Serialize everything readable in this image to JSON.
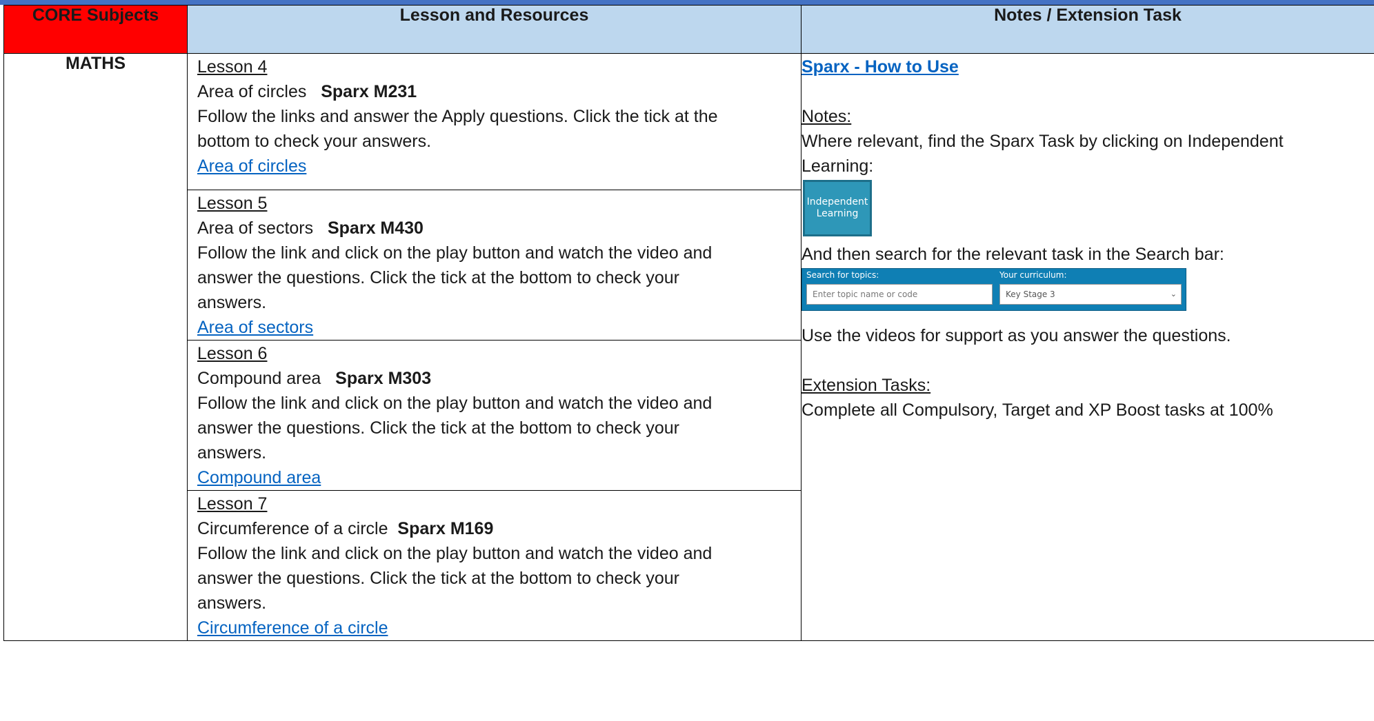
{
  "table": {
    "headers": {
      "core": "CORE Subjects",
      "lessons": "Lesson and Resources",
      "notes": "Notes / Extension Task"
    },
    "subject": "MATHS",
    "lessons": [
      {
        "title": "Lesson 4",
        "topic": "Area of circles",
        "code": "Sparx M231",
        "line1": "Follow the links and answer the Apply questions. Click the tick at the",
        "line2": "bottom to check your answers.",
        "line3": "",
        "link": "Area of circles"
      },
      {
        "title": "Lesson 5",
        "topic": "Area of sectors",
        "code": "Sparx M430",
        "line1": "Follow the link and click on the play button and watch the video and",
        "line2": "answer the questions. Click the tick at the bottom to check your",
        "line3": "answers.",
        "link": "Area of sectors"
      },
      {
        "title": "Lesson 6",
        "topic": "Compound area",
        "code": "Sparx M303",
        "line1": "Follow the link and click on the play button and watch the video and",
        "line2": "answer the questions. Click the tick at the bottom to check your",
        "line3": "answers.",
        "link": "Compound area"
      },
      {
        "title": "Lesson 7",
        "topic": "Circumference of a circle",
        "code": "Sparx M169",
        "line1": "Follow the link and click on the play button and watch the video and",
        "line2": "answer the questions. Click the tick at the bottom to check your",
        "line3": "answers.",
        "link": "Circumference of a circle"
      }
    ]
  },
  "notes": {
    "how_to_link": "Sparx - How to Use",
    "notes_heading": "Notes:",
    "notes_line1": "Where relevant, find the Sparx Task by clicking on Independent",
    "notes_line2": "Learning:",
    "independent_learning_button": {
      "line1": "Independent",
      "line2": "Learning"
    },
    "search_instruction": "And then search for the relevant task in the Search bar:",
    "search_bar": {
      "topics_label": "Search for topics:",
      "topics_placeholder": "Enter topic name or code",
      "curriculum_label": "Your curriculum:",
      "curriculum_value": "Key Stage 3"
    },
    "videos_line": "Use the videos for support as you answer the questions.",
    "extension_heading": "Extension Tasks:",
    "extension_line": "Complete all Compulsory, Target and XP Boost tasks at 100%"
  }
}
